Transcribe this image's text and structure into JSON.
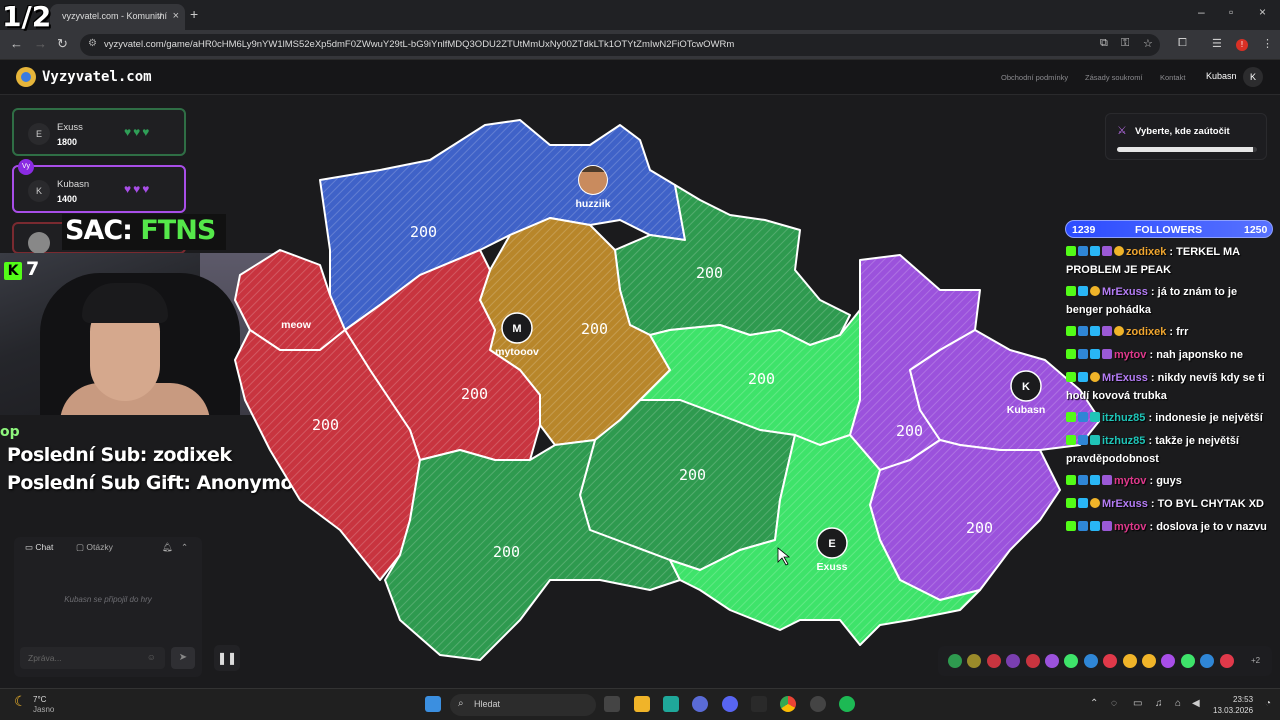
{
  "browser": {
    "tab_title": "vyzyvatel.com - Komunitní",
    "url": "vyzyvatel.com/game/aHR0cHM6Ly9nYW1lMS52eXp5dmF0ZWwuY29tL-bG9iYnlfMDQ3ODU2ZTUtMmUxNy00ZTdkLTk1OTYtZmIwN2FiOTcwOWRm"
  },
  "header": {
    "logo": "Vyzyvatel.com",
    "links": [
      "Obchodní podmínky",
      "Zásady soukromí",
      "Kontakt"
    ],
    "username": "Kubasn",
    "avatar_letter": "K"
  },
  "players": [
    {
      "initial": "E",
      "name": "Exuss",
      "score": "1800",
      "heart_color": "#2f9e57",
      "self": false
    },
    {
      "initial": "K",
      "name": "Kubasn",
      "score": "1400",
      "heart_color": "#a84ee8",
      "self": true,
      "badge": "Vy"
    }
  ],
  "overlay": {
    "counter": "1/2",
    "sac_prefix": "SAC: ",
    "sac_name": "FTNS",
    "kick_viewers": "7",
    "op_fragment": "op",
    "last_sub": "Poslední Sub: zodixek",
    "last_sub_gift": "Poslední Sub Gift: Anonymous"
  },
  "chat": {
    "tab_chat": "Chat",
    "tab_questions": "Otázky",
    "message": "Kubasn se připojil do hry",
    "input_placeholder": "Zpráva..."
  },
  "map": {
    "regions": [
      {
        "id": "liberec",
        "color": "#3f62c8",
        "value": "200"
      },
      {
        "id": "hradec",
        "color": "#2e9a4f",
        "value": "200"
      },
      {
        "id": "praha",
        "color": "#b8862a",
        "value": "200"
      },
      {
        "id": "karlovy",
        "color": "#c8343f",
        "value": "200"
      },
      {
        "id": "plzen",
        "color": "#c8343f",
        "value": "200"
      },
      {
        "id": "stredocesky",
        "color": "#c8343f",
        "value": "200"
      },
      {
        "id": "pardubice",
        "color": "#3ee36a",
        "value": "200"
      },
      {
        "id": "vysocina",
        "color": "#2e9a4f",
        "value": "200"
      },
      {
        "id": "jihocesky",
        "color": "#2e9a4f",
        "value": "200"
      },
      {
        "id": "olomouc",
        "color": "#9b52dc",
        "value": "200"
      },
      {
        "id": "moravskoslezsky",
        "color": "#9b52dc",
        "value": "200"
      },
      {
        "id": "zlin",
        "color": "#9b52dc",
        "value": "200"
      },
      {
        "id": "jihomoravsky",
        "color": "#3ee36a",
        "value": "200"
      }
    ],
    "markers": [
      {
        "label": "huzziik",
        "letter": ""
      },
      {
        "label": "mytooov",
        "letter": "M"
      },
      {
        "label": "Kubasn",
        "letter": "K"
      },
      {
        "label": "Exuss",
        "letter": "E"
      },
      {
        "label": "meow",
        "letter": ""
      }
    ]
  },
  "attack": {
    "text": "Vyberte, kde zaútočit",
    "progress": 0.97
  },
  "followers": {
    "current": "1239",
    "label": "FOLLOWERS",
    "goal": "1250"
  },
  "stream_chat": [
    {
      "user": "zodixek",
      "color": "#f0a630",
      "text": "TERKEL MA PROBLEM JE PEAK",
      "badges": [
        "kick",
        "blue",
        "cyan",
        "purple",
        "gold"
      ]
    },
    {
      "user": "MrExuss",
      "color": "#b47cf5",
      "text": "já to znám to je benger pohádka",
      "badges": [
        "kick",
        "cyan",
        "gold"
      ]
    },
    {
      "user": "zodixek",
      "color": "#f0a630",
      "text": "frr",
      "badges": [
        "kick",
        "blue",
        "cyan",
        "purple",
        "gold"
      ]
    },
    {
      "user": "mytov",
      "color": "#e0398c",
      "text": "nah japonsko ne",
      "badges": [
        "kick",
        "blue",
        "cyan",
        "purple"
      ]
    },
    {
      "user": "MrExuss",
      "color": "#b47cf5",
      "text": "nikdy nevíš kdy se ti hodí kovová trubka",
      "badges": [
        "kick",
        "cyan",
        "gold"
      ]
    },
    {
      "user": "itzhuz85",
      "color": "#1fc4b7",
      "text": "indonesie je největší",
      "badges": [
        "kick",
        "blue",
        "teal"
      ]
    },
    {
      "user": "itzhuz85",
      "color": "#1fc4b7",
      "text": "takže je největší pravděpodobnost",
      "badges": [
        "kick",
        "blue",
        "teal"
      ]
    },
    {
      "user": "mytov",
      "color": "#e0398c",
      "text": "guys",
      "badges": [
        "kick",
        "blue",
        "cyan",
        "purple"
      ]
    },
    {
      "user": "MrExuss",
      "color": "#b47cf5",
      "text": "TO BYL CHYTAK XD",
      "badges": [
        "kick",
        "cyan",
        "gold"
      ]
    },
    {
      "user": "mytov",
      "color": "#e0398c",
      "text": "doslova je to v nazvu",
      "badges": [
        "kick",
        "blue",
        "cyan",
        "purple"
      ]
    }
  ],
  "palette": {
    "colors": [
      "#2e9a4f",
      "#9a8a2a",
      "#c8343f",
      "#7a3fb0",
      "#c8343f",
      "#9b52dc",
      "#3ee36a",
      "#2f86d6",
      "#e0394a",
      "#f0b429",
      "#f0b429",
      "#a84ee8",
      "#3ee36a",
      "#2f86d6",
      "#e0394a"
    ],
    "more": "+2"
  },
  "taskbar": {
    "temp": "7°C",
    "weather": "Jasno",
    "search": "Hledat",
    "time": "23:53",
    "date": "13.03.2026"
  }
}
